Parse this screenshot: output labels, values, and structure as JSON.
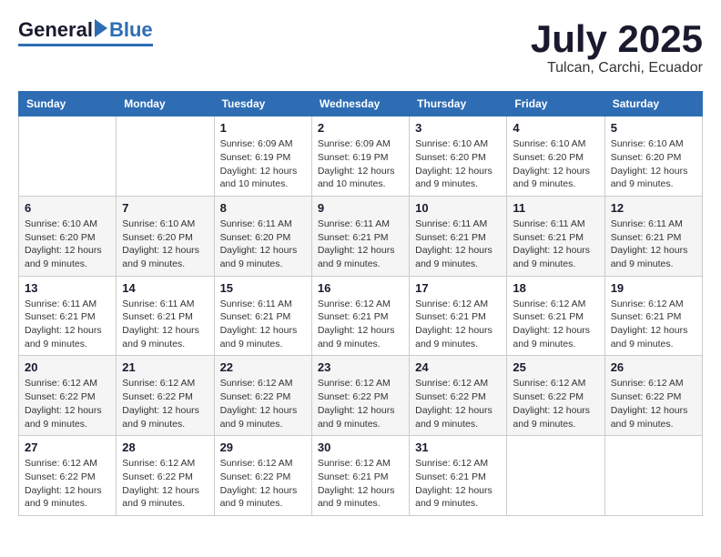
{
  "logo": {
    "general": "General",
    "blue": "Blue"
  },
  "title": {
    "month": "July 2025",
    "location": "Tulcan, Carchi, Ecuador"
  },
  "headers": [
    "Sunday",
    "Monday",
    "Tuesday",
    "Wednesday",
    "Thursday",
    "Friday",
    "Saturday"
  ],
  "weeks": [
    [
      {
        "day": "",
        "info": ""
      },
      {
        "day": "",
        "info": ""
      },
      {
        "day": "1",
        "info": "Sunrise: 6:09 AM\nSunset: 6:19 PM\nDaylight: 12 hours and 10 minutes."
      },
      {
        "day": "2",
        "info": "Sunrise: 6:09 AM\nSunset: 6:19 PM\nDaylight: 12 hours and 10 minutes."
      },
      {
        "day": "3",
        "info": "Sunrise: 6:10 AM\nSunset: 6:20 PM\nDaylight: 12 hours and 9 minutes."
      },
      {
        "day": "4",
        "info": "Sunrise: 6:10 AM\nSunset: 6:20 PM\nDaylight: 12 hours and 9 minutes."
      },
      {
        "day": "5",
        "info": "Sunrise: 6:10 AM\nSunset: 6:20 PM\nDaylight: 12 hours and 9 minutes."
      }
    ],
    [
      {
        "day": "6",
        "info": "Sunrise: 6:10 AM\nSunset: 6:20 PM\nDaylight: 12 hours and 9 minutes."
      },
      {
        "day": "7",
        "info": "Sunrise: 6:10 AM\nSunset: 6:20 PM\nDaylight: 12 hours and 9 minutes."
      },
      {
        "day": "8",
        "info": "Sunrise: 6:11 AM\nSunset: 6:20 PM\nDaylight: 12 hours and 9 minutes."
      },
      {
        "day": "9",
        "info": "Sunrise: 6:11 AM\nSunset: 6:21 PM\nDaylight: 12 hours and 9 minutes."
      },
      {
        "day": "10",
        "info": "Sunrise: 6:11 AM\nSunset: 6:21 PM\nDaylight: 12 hours and 9 minutes."
      },
      {
        "day": "11",
        "info": "Sunrise: 6:11 AM\nSunset: 6:21 PM\nDaylight: 12 hours and 9 minutes."
      },
      {
        "day": "12",
        "info": "Sunrise: 6:11 AM\nSunset: 6:21 PM\nDaylight: 12 hours and 9 minutes."
      }
    ],
    [
      {
        "day": "13",
        "info": "Sunrise: 6:11 AM\nSunset: 6:21 PM\nDaylight: 12 hours and 9 minutes."
      },
      {
        "day": "14",
        "info": "Sunrise: 6:11 AM\nSunset: 6:21 PM\nDaylight: 12 hours and 9 minutes."
      },
      {
        "day": "15",
        "info": "Sunrise: 6:11 AM\nSunset: 6:21 PM\nDaylight: 12 hours and 9 minutes."
      },
      {
        "day": "16",
        "info": "Sunrise: 6:12 AM\nSunset: 6:21 PM\nDaylight: 12 hours and 9 minutes."
      },
      {
        "day": "17",
        "info": "Sunrise: 6:12 AM\nSunset: 6:21 PM\nDaylight: 12 hours and 9 minutes."
      },
      {
        "day": "18",
        "info": "Sunrise: 6:12 AM\nSunset: 6:21 PM\nDaylight: 12 hours and 9 minutes."
      },
      {
        "day": "19",
        "info": "Sunrise: 6:12 AM\nSunset: 6:21 PM\nDaylight: 12 hours and 9 minutes."
      }
    ],
    [
      {
        "day": "20",
        "info": "Sunrise: 6:12 AM\nSunset: 6:22 PM\nDaylight: 12 hours and 9 minutes."
      },
      {
        "day": "21",
        "info": "Sunrise: 6:12 AM\nSunset: 6:22 PM\nDaylight: 12 hours and 9 minutes."
      },
      {
        "day": "22",
        "info": "Sunrise: 6:12 AM\nSunset: 6:22 PM\nDaylight: 12 hours and 9 minutes."
      },
      {
        "day": "23",
        "info": "Sunrise: 6:12 AM\nSunset: 6:22 PM\nDaylight: 12 hours and 9 minutes."
      },
      {
        "day": "24",
        "info": "Sunrise: 6:12 AM\nSunset: 6:22 PM\nDaylight: 12 hours and 9 minutes."
      },
      {
        "day": "25",
        "info": "Sunrise: 6:12 AM\nSunset: 6:22 PM\nDaylight: 12 hours and 9 minutes."
      },
      {
        "day": "26",
        "info": "Sunrise: 6:12 AM\nSunset: 6:22 PM\nDaylight: 12 hours and 9 minutes."
      }
    ],
    [
      {
        "day": "27",
        "info": "Sunrise: 6:12 AM\nSunset: 6:22 PM\nDaylight: 12 hours and 9 minutes."
      },
      {
        "day": "28",
        "info": "Sunrise: 6:12 AM\nSunset: 6:22 PM\nDaylight: 12 hours and 9 minutes."
      },
      {
        "day": "29",
        "info": "Sunrise: 6:12 AM\nSunset: 6:22 PM\nDaylight: 12 hours and 9 minutes."
      },
      {
        "day": "30",
        "info": "Sunrise: 6:12 AM\nSunset: 6:21 PM\nDaylight: 12 hours and 9 minutes."
      },
      {
        "day": "31",
        "info": "Sunrise: 6:12 AM\nSunset: 6:21 PM\nDaylight: 12 hours and 9 minutes."
      },
      {
        "day": "",
        "info": ""
      },
      {
        "day": "",
        "info": ""
      }
    ]
  ]
}
